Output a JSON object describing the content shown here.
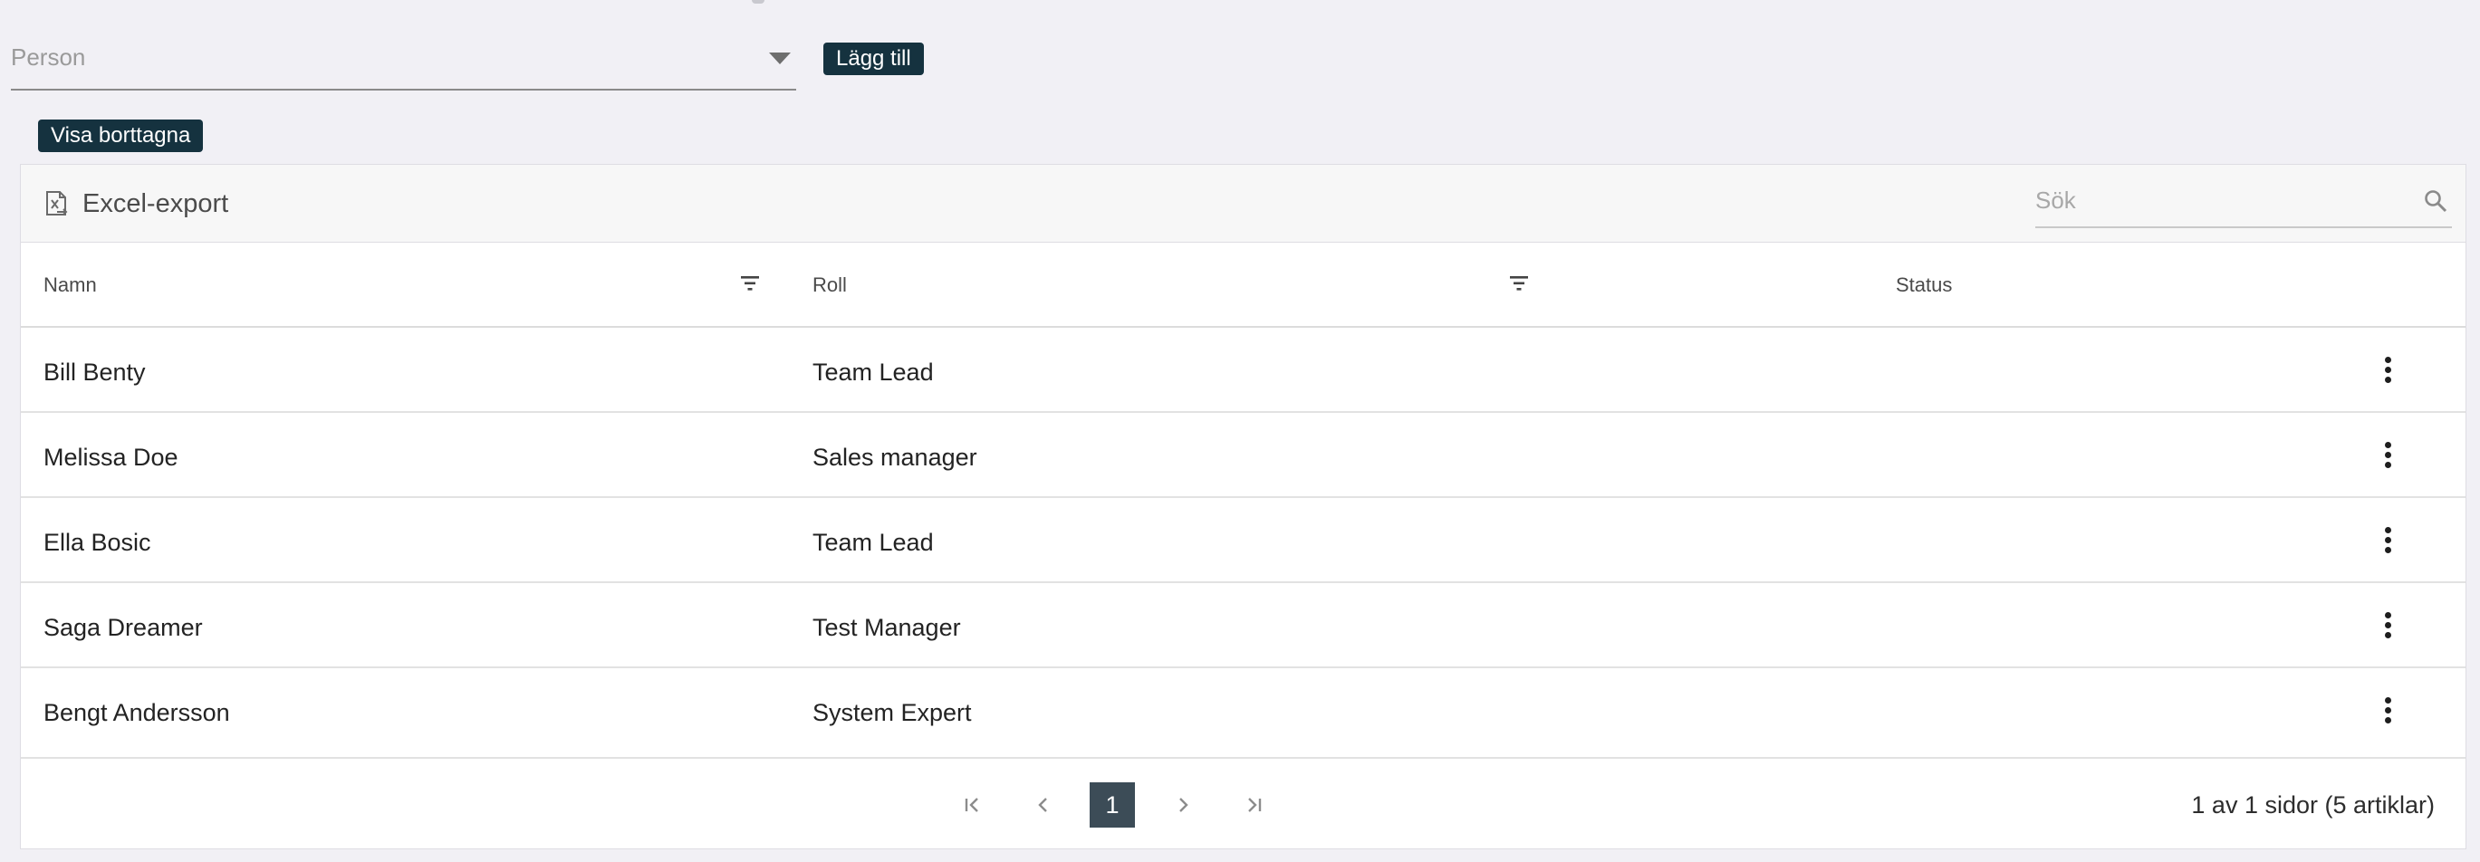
{
  "top_form": {
    "person_placeholder": "Person",
    "add_label": "Lägg till",
    "show_deleted_label": "Visa borttagna"
  },
  "toolbar": {
    "export_label": "Excel-export",
    "search_placeholder": "Sök"
  },
  "table": {
    "columns": [
      "Namn",
      "Roll",
      "Status"
    ],
    "rows": [
      {
        "name": "Bill Benty",
        "role": "Team Lead",
        "status": ""
      },
      {
        "name": "Melissa Doe",
        "role": "Sales manager",
        "status": ""
      },
      {
        "name": "Ella Bosic",
        "role": "Team Lead",
        "status": ""
      },
      {
        "name": "Saga Dreamer",
        "role": "Test Manager",
        "status": ""
      },
      {
        "name": "Bengt Andersson",
        "role": "System Expert",
        "status": ""
      }
    ]
  },
  "pager": {
    "current_page": "1",
    "info": "1 av 1 sidor (5 artiklar)"
  },
  "colors": {
    "background": "#f1f0f5",
    "button_dark": "#15323f",
    "active_page": "#3c4c57"
  },
  "icons": [
    "excel-export-icon",
    "search-icon",
    "filter-icon",
    "kebab-menu-icon",
    "first-page-icon",
    "prev-page-icon",
    "next-page-icon",
    "last-page-icon",
    "dropdown-caret-icon"
  ]
}
